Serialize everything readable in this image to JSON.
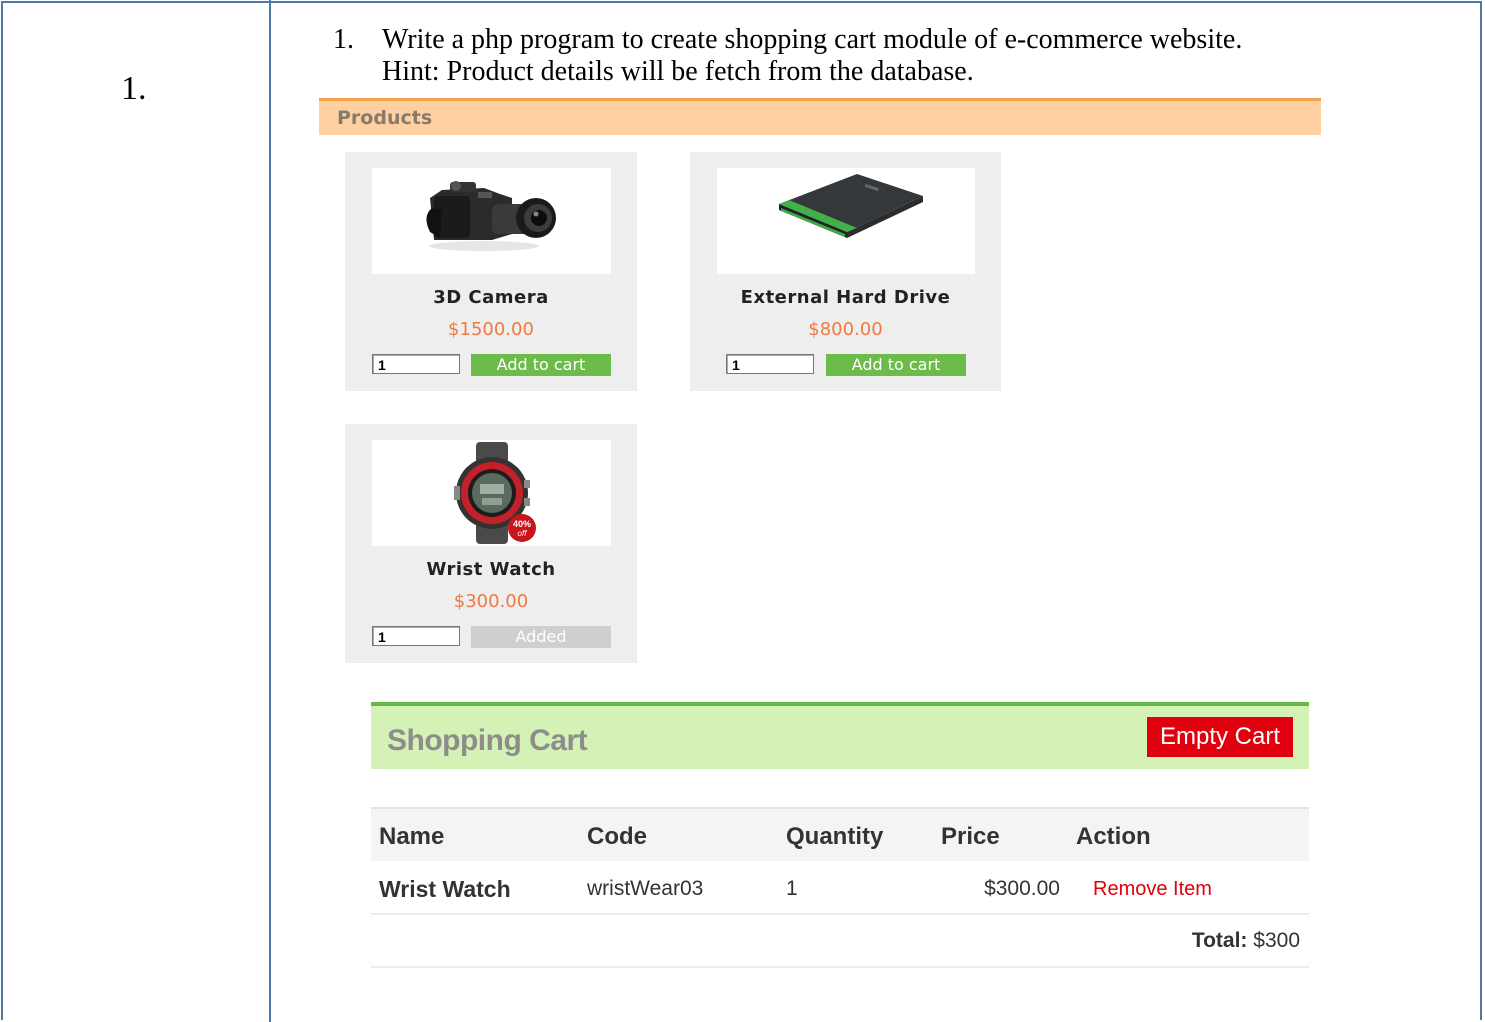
{
  "row": {
    "number": "1."
  },
  "question": {
    "number": "1.",
    "lines": [
      "Write a php program to create shopping cart module of e-commerce website.",
      "Hint: Product details will be fetch from the database."
    ]
  },
  "products": {
    "heading": "Products",
    "items": [
      {
        "name": "3D Camera",
        "price": "$1500.00",
        "qty": "1",
        "button": "Add to cart",
        "icon": "camera-icon"
      },
      {
        "name": "External Hard Drive",
        "price": "$800.00",
        "qty": "1",
        "button": "Add to cart",
        "icon": "hard-drive-icon"
      },
      {
        "name": "Wrist Watch",
        "price": "$300.00",
        "qty": "1",
        "button": "Added",
        "icon": "wrist-watch-icon",
        "badge": [
          "40%",
          "off"
        ]
      }
    ]
  },
  "cart": {
    "title": "Shopping Cart",
    "empty_button": "Empty Cart",
    "columns": [
      "Name",
      "Code",
      "Quantity",
      "Price",
      "Action"
    ],
    "rows": [
      {
        "name": "Wrist Watch",
        "code": "wristWear03",
        "quantity": "1",
        "price": "$300.00",
        "action": "Remove Item"
      }
    ],
    "total_label": "Total:",
    "total_value": "$300"
  },
  "colors": {
    "border": "#4f79a6",
    "products_bar": "#ffd0a2",
    "add_button": "#6cbb4b",
    "price": "#f07a40",
    "cart_header": "#d4f2b5",
    "empty_button": "#e0000e",
    "remove_link": "#e0000e"
  }
}
